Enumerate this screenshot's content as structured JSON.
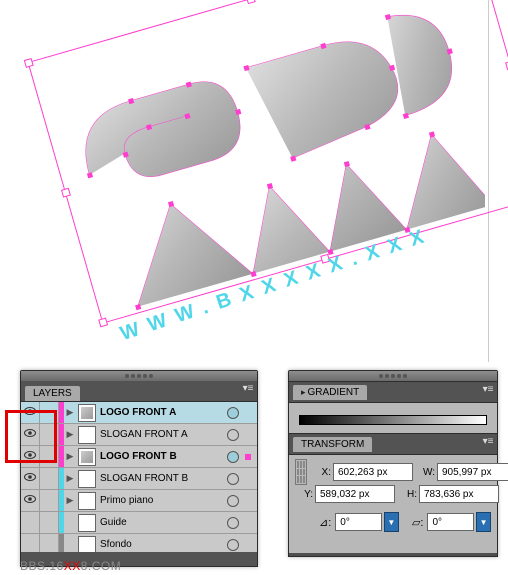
{
  "canvas": {
    "url_text": "WWW.BXXXXX.XXX"
  },
  "layers_panel": {
    "tab_label": "LAYERS",
    "layers": [
      {
        "name": "LOGO FRONT A",
        "bold": true,
        "color": "#ff3dcf",
        "selected": true,
        "eye": true,
        "disclosure": true,
        "sel_ind": false,
        "target_filled": true,
        "thumb": "logo"
      },
      {
        "name": "SLOGAN FRONT A",
        "bold": false,
        "color": "#ff3dcf",
        "selected": false,
        "eye": true,
        "disclosure": true,
        "sel_ind": false,
        "target_filled": false,
        "thumb": "empty"
      },
      {
        "name": "LOGO FRONT B",
        "bold": true,
        "color": "#ff3dcf",
        "selected": false,
        "eye": true,
        "disclosure": true,
        "sel_ind": true,
        "target_filled": true,
        "thumb": "logo"
      },
      {
        "name": "SLOGAN FRONT B",
        "bold": false,
        "color": "#4fd6e8",
        "selected": false,
        "eye": true,
        "disclosure": true,
        "sel_ind": false,
        "target_filled": false,
        "thumb": "empty"
      },
      {
        "name": "Primo piano",
        "bold": false,
        "color": "#4fd6e8",
        "selected": false,
        "eye": true,
        "disclosure": true,
        "sel_ind": false,
        "target_filled": false,
        "thumb": "empty"
      },
      {
        "name": "Guide",
        "bold": false,
        "color": "#4fd6e8",
        "selected": false,
        "eye": false,
        "disclosure": false,
        "sel_ind": false,
        "target_filled": false,
        "thumb": "empty"
      },
      {
        "name": "Sfondo",
        "bold": false,
        "color": "#888888",
        "selected": false,
        "eye": false,
        "disclosure": false,
        "sel_ind": false,
        "target_filled": false,
        "thumb": "empty"
      }
    ]
  },
  "gradient_panel": {
    "tab_label": "GRADIENT"
  },
  "transform_panel": {
    "tab_label": "TRANSFORM",
    "x_label": "X:",
    "x_value": "602,263 px",
    "y_label": "Y:",
    "y_value": "589,032 px",
    "w_label": "W:",
    "w_value": "905,997 px",
    "h_label": "H:",
    "h_value": "783,636 px",
    "rotate_value": "0°",
    "shear_value": "0°"
  },
  "watermark": {
    "pre": "BBS.16",
    "xx": "XX",
    "post": "8.COM"
  }
}
